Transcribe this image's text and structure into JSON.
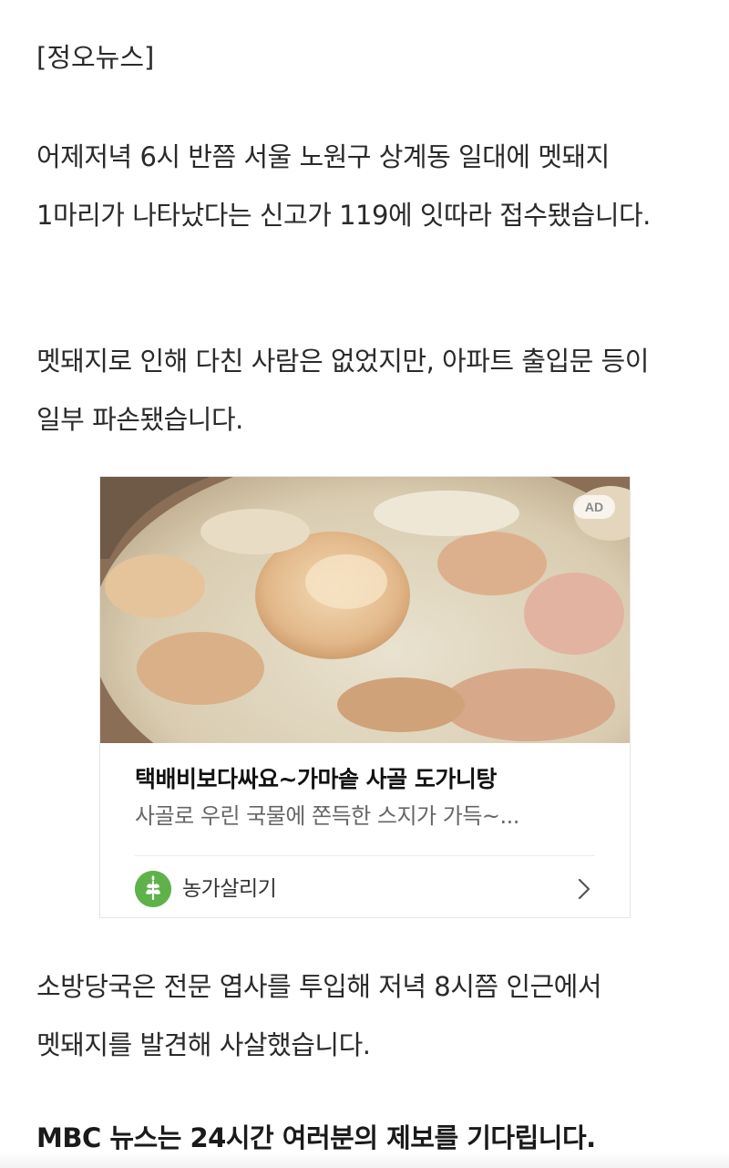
{
  "article": {
    "source_tag": "[정오뉴스]",
    "paragraphs": [
      "어제저녁 6시 반쯤 서울 노원구 상계동 일대에 멧돼지 1마리가 나타났다는 신고가 119에 잇따라 접수됐습니다.",
      "멧돼지로 인해 다친 사람은 없었지만, 아파트 출입문 등이 일부 파손됐습니다.",
      "소방당국은 전문 엽사를 투입해 저녁 8시쯤 인근에서 멧돼지를 발견해 사살했습니다.",
      "MBC 뉴스는 24시간 여러분의 제보를 기다립니다."
    ]
  },
  "ad": {
    "badge": "AD",
    "title": "택배비보다싸요~가마솥 사골 도가니탕",
    "description": "사골로 우린 국물에 쫀득한 스지가 가득~...",
    "brand_name": "농가살리기",
    "image_icon": "soup-photo",
    "brand_icon": "leaf-logo-icon",
    "chevron_icon": "chevron-right-icon"
  },
  "colors": {
    "text": "#2a2a2a",
    "ad_desc": "#666666",
    "brand_green": "#5fb24a"
  }
}
